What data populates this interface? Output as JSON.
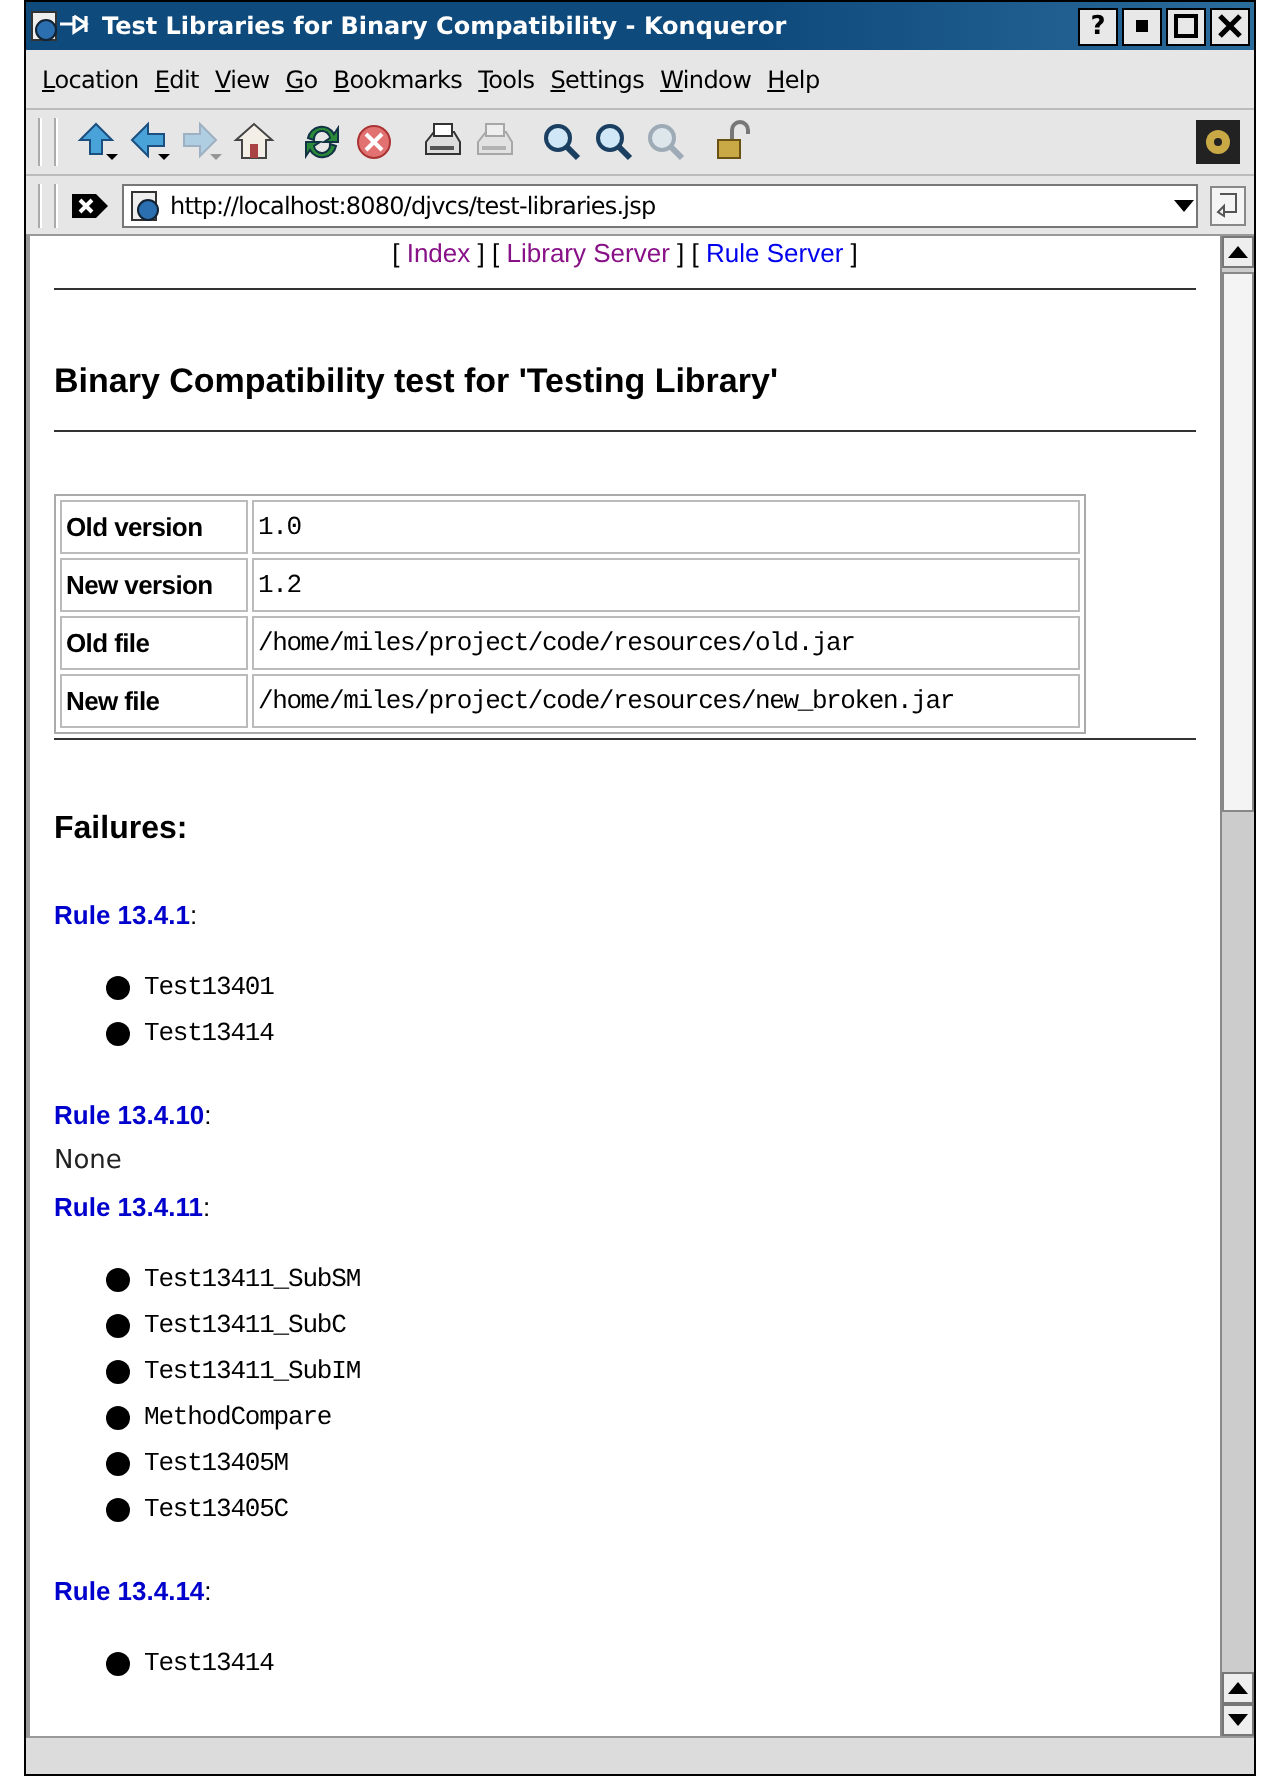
{
  "window": {
    "title": "Test Libraries for Binary Compatibility - Konqueror",
    "help_button": "?"
  },
  "menu": [
    "Location",
    "Edit",
    "View",
    "Go",
    "Bookmarks",
    "Tools",
    "Settings",
    "Window",
    "Help"
  ],
  "toolbar": [
    {
      "kind": "up",
      "disabled": false
    },
    {
      "kind": "back",
      "disabled": false
    },
    {
      "kind": "forward",
      "disabled": true
    },
    {
      "kind": "home",
      "disabled": false
    },
    {
      "kind": "reload",
      "disabled": false
    },
    {
      "kind": "stop",
      "disabled": false
    },
    {
      "kind": "print",
      "disabled": false
    },
    {
      "kind": "print",
      "disabled": true
    },
    {
      "kind": "zoom",
      "disabled": false
    },
    {
      "kind": "zoom",
      "disabled": false
    },
    {
      "kind": "zoom",
      "disabled": true
    },
    {
      "kind": "lock",
      "disabled": false
    }
  ],
  "location": {
    "url": "http://localhost:8080/djvcs/test-libraries.jsp"
  },
  "nav_links": [
    {
      "open": "[",
      "label": "Index",
      "close": "]",
      "visited": true
    },
    {
      "open": "[",
      "label": "Library Server",
      "close": "]",
      "visited": true
    },
    {
      "open": "[",
      "label": "Rule Server",
      "close": "]",
      "visited": false
    }
  ],
  "heading": "Binary Compatibility test for 'Testing Library'",
  "info_table": [
    {
      "label": "Old version",
      "value": "1.0"
    },
    {
      "label": "New version",
      "value": "1.2"
    },
    {
      "label": "Old file",
      "value": "/home/miles/project/code/resources/old.jar"
    },
    {
      "label": "New file",
      "value": "/home/miles/project/code/resources/new_broken.jar"
    }
  ],
  "failures_heading": "Failures:",
  "rules": [
    {
      "name": "Rule 13.4.1",
      "suffix": ":",
      "kind": "list",
      "tests": [
        "Test13401",
        "Test13414"
      ]
    },
    {
      "name": "Rule 13.4.10",
      "suffix": ":",
      "kind": "text",
      "text": "None"
    },
    {
      "name": "Rule 13.4.11",
      "suffix": ":",
      "kind": "list",
      "tests": [
        "Test13411_SubSM",
        "Test13411_SubC",
        "Test13411_SubIM",
        "MethodCompare",
        "Test13405M",
        "Test13405C"
      ]
    },
    {
      "name": "Rule 13.4.14",
      "suffix": ":",
      "kind": "list",
      "tests": [
        "Test13414"
      ]
    }
  ]
}
